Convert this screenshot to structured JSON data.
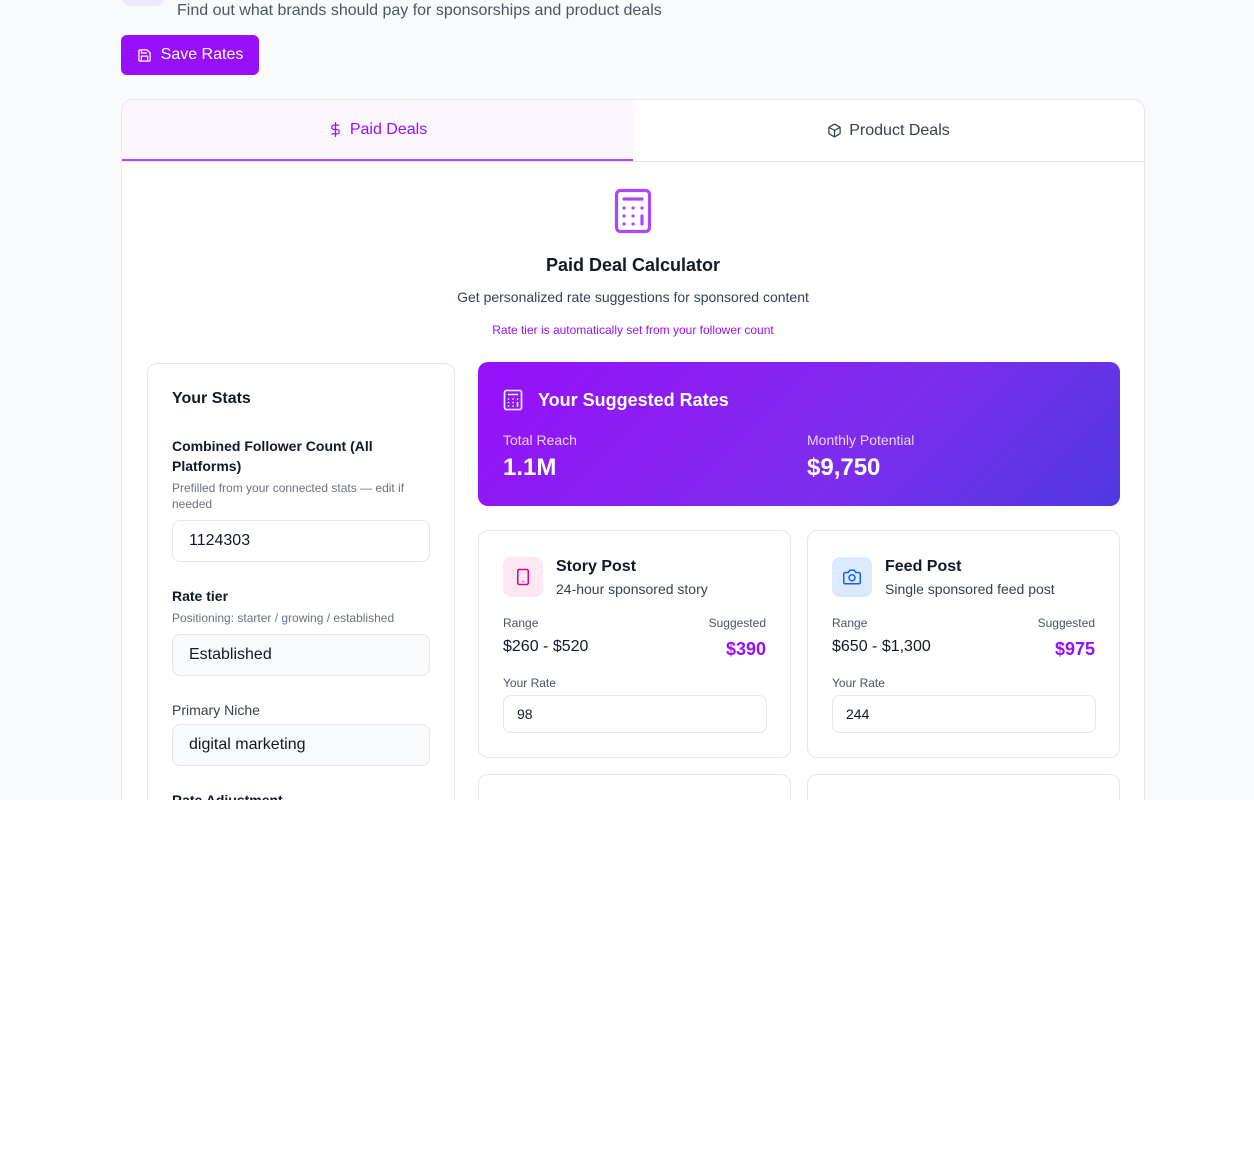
{
  "header": {
    "subtitle": "Find out what brands should pay for sponsorships and product deals",
    "save_label": "Save Rates"
  },
  "tabs": [
    {
      "label": "Paid Deals",
      "icon": "dollar-icon",
      "active": true
    },
    {
      "label": "Product Deals",
      "icon": "package-icon",
      "active": false
    }
  ],
  "calculator": {
    "title": "Paid Deal Calculator",
    "subtitle": "Get personalized rate suggestions for sponsored content",
    "note": "Rate tier is automatically set from your follower count"
  },
  "stats": {
    "title": "Your Stats",
    "follower_label": "Combined Follower Count (All Platforms)",
    "follower_help": "Prefilled from your connected stats — edit if needed",
    "follower_value": "1124303",
    "tier_label": "Rate tier",
    "tier_help": "Positioning: starter / growing / established",
    "tier_value": "Established",
    "niche_label": "Primary Niche",
    "niche_value": "digital marketing",
    "adjust_label": "Rate Adjustment"
  },
  "suggested": {
    "title": "Your Suggested Rates",
    "reach_label": "Total Reach",
    "reach_value": "1.1M",
    "monthly_label": "Monthly Potential",
    "monthly_value": "$9,750"
  },
  "cards": [
    {
      "title": "Story Post",
      "subtitle": "24-hour sponsored story",
      "icon": "smartphone-icon",
      "range_label": "Range",
      "range": "$260 - $520",
      "suggested_label": "Suggested",
      "suggested": "$390",
      "rate_label": "Your Rate",
      "rate": "98"
    },
    {
      "title": "Feed Post",
      "subtitle": "Single sponsored feed post",
      "icon": "camera-icon",
      "range_label": "Range",
      "range": "$650 - $1,300",
      "suggested_label": "Suggested",
      "suggested": "$975",
      "rate_label": "Your Rate",
      "rate": "244"
    }
  ],
  "colors": {
    "accent": "#9810fa",
    "accent_light": "#faf5ff",
    "gradient_end": "#4f39e0",
    "story_icon_bg": "#fce7f3",
    "feed_icon_bg": "#dbeafe"
  }
}
